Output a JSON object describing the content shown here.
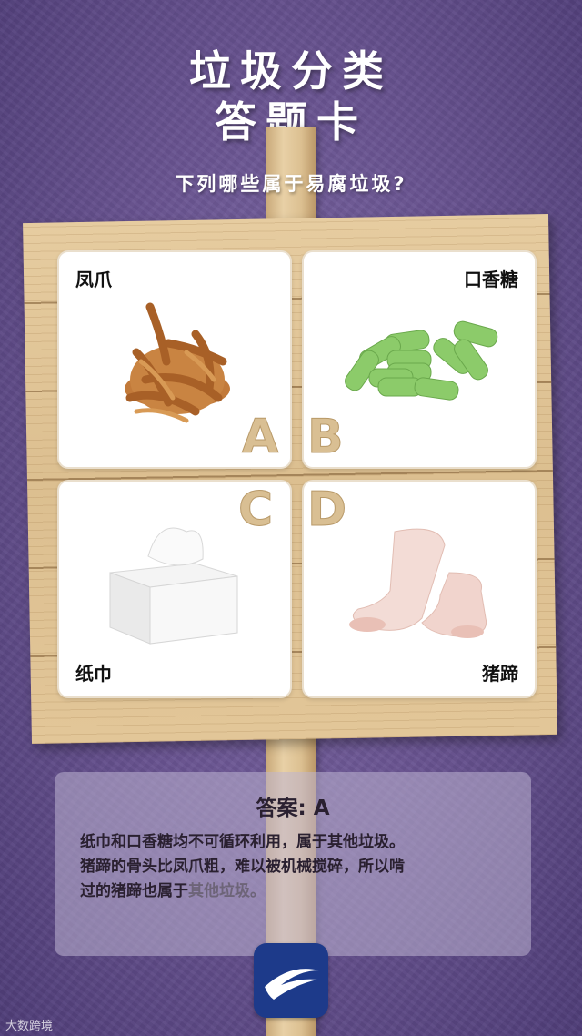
{
  "title": {
    "line1": "垃圾分类",
    "line2": "答题卡"
  },
  "question": "下列哪些属于易腐垃圾?",
  "options": [
    {
      "letter": "A",
      "label": "凤爪"
    },
    {
      "letter": "B",
      "label": "口香糖"
    },
    {
      "letter": "C",
      "label": "纸巾"
    },
    {
      "letter": "D",
      "label": "猪蹄"
    }
  ],
  "answer": {
    "title": "答案: A",
    "line1": "纸巾和口香糖均不可循环利用，属于其他垃圾。",
    "line2": "猪蹄的骨头比凤爪粗，难以被机械搅碎，所以啃",
    "line3_a": "过的猪蹄也属于",
    "line3_b": "其他垃圾。"
  },
  "watermark": "大数跨境",
  "colors": {
    "background": "#6a5592",
    "board": "#dcbf90",
    "logo": "#1d3a8a",
    "gum": "#8ccb6a"
  }
}
